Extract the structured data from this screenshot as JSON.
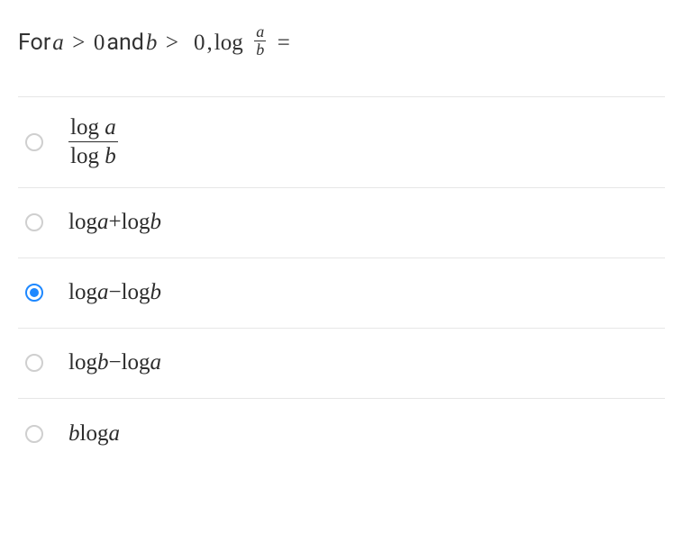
{
  "question": {
    "text_prefix": "For ",
    "cond1_a": "a",
    "gt1": ">",
    "cond1_zero": "0",
    "and": " and ",
    "cond2_b": "b",
    "gt2": ">",
    "cond2_zero": "0",
    "comma": ", ",
    "log": "log",
    "frac_num": "a",
    "frac_den": "b",
    "equals": "="
  },
  "options": [
    {
      "type": "fraction",
      "num_prefix": "log ",
      "num_var": "a",
      "den_prefix": "log ",
      "den_var": "b",
      "selected": false
    },
    {
      "type": "expr",
      "p1": "log ",
      "v1": "a",
      "op": " + ",
      "p2": "log ",
      "v2": "b",
      "selected": false
    },
    {
      "type": "expr",
      "p1": "log ",
      "v1": "a",
      "op": " − ",
      "p2": "log ",
      "v2": "b",
      "selected": true
    },
    {
      "type": "expr",
      "p1": "log ",
      "v1": "b",
      "op": " − ",
      "p2": "log ",
      "v2": "a",
      "selected": false
    },
    {
      "type": "simple",
      "v0": "b",
      "p1": " log ",
      "v1": "a",
      "selected": false
    }
  ]
}
